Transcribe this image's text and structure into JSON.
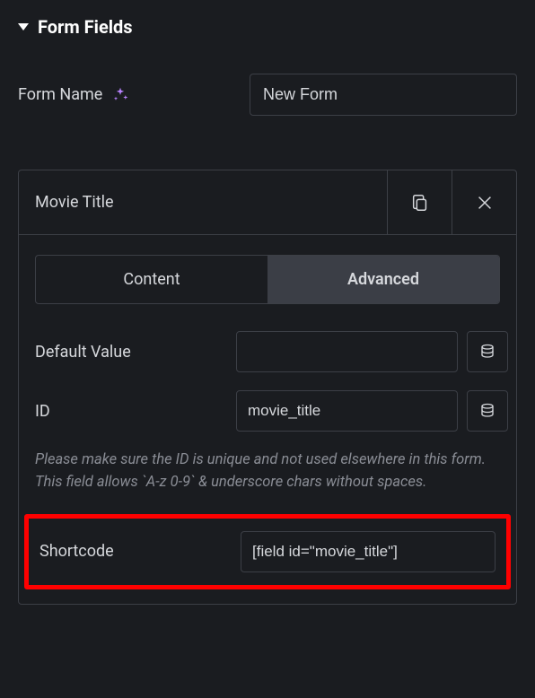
{
  "section": {
    "title": "Form Fields"
  },
  "formName": {
    "label": "Form Name",
    "value": "New Form"
  },
  "field": {
    "title": "Movie Title",
    "tabs": {
      "content": "Content",
      "advanced": "Advanced"
    },
    "defaultValue": {
      "label": "Default Value",
      "value": ""
    },
    "id": {
      "label": "ID",
      "value": "movie_title"
    },
    "help": "Please make sure the ID is unique and not used elsewhere in this form. This field allows `A-z 0-9` & underscore chars without spaces.",
    "shortcode": {
      "label": "Shortcode",
      "value": "[field id=\"movie_title\"]"
    }
  }
}
